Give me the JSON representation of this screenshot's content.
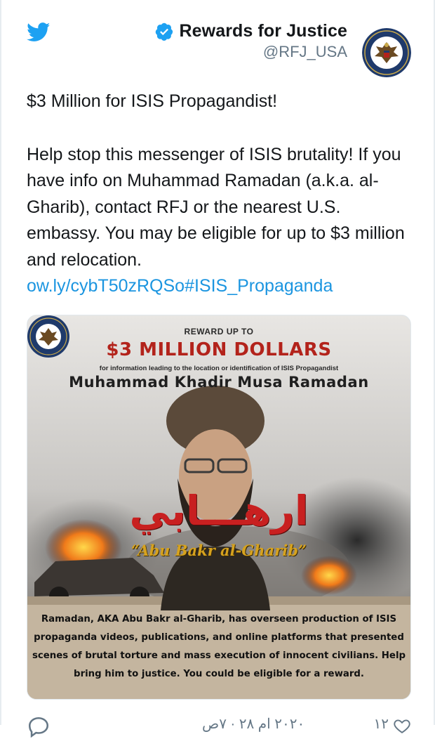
{
  "author": {
    "display_name": "Rewards for Justice",
    "handle": "@RFJ_USA",
    "verified_icon": "verified-badge-icon",
    "avatar_icon": "state-department-seal-icon",
    "twitter_icon": "twitter-bird-icon"
  },
  "tweet": {
    "headline": "$3 Million for ISIS Propagandist!",
    "body": "Help stop this messenger of ISIS brutality! If you have info on Muhammad Ramadan (a.k.a. al-Gharib),  contact RFJ  or the nearest U.S. embassy. You may be eligible for up to $3 million and relocation.",
    "link": "ow.ly/cybT50zRQSo#ISIS_Propaganda"
  },
  "poster": {
    "reward_up_to": "REWARD UP TO",
    "amount": "$3 MILLION DOLLARS",
    "for_info": "for information leading to the location or identification of ISIS Propagandist",
    "name": "Muhammad Khadir Musa Ramadan",
    "arabic": "ارهـــابي",
    "aka": "“Abu Bakr al-Gharib”",
    "paragraph": "Ramadan, AKA Abu Bakr al-Gharib, has overseen production of ISIS propaganda videos, publications, and online platforms that presented scenes of brutal torture and mass execution of innocent civilians. Help bring him to justice. You could be eligible for a reward."
  },
  "actions": {
    "reply_icon": "reply-icon",
    "timestamp_partial": "٢٠٢٠ ‏ام ٢٨ ‏· ‏٧ص",
    "like_count": "١٢",
    "like_icon": "heart-icon"
  },
  "colors": {
    "link": "#1b95e0",
    "verified": "#1da1f2",
    "twitter": "#1da1f2",
    "poster_red": "#b3231b",
    "poster_gold": "#d6a21e"
  }
}
